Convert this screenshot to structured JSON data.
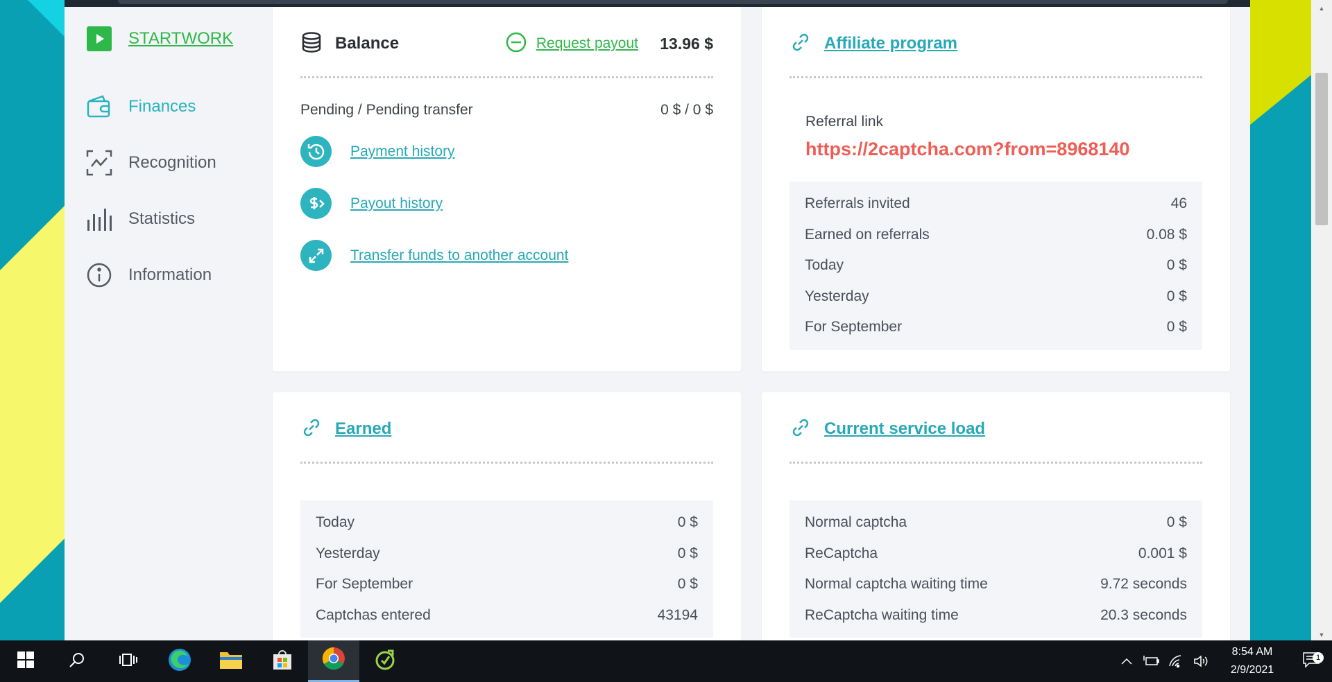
{
  "sidebar": {
    "items": [
      {
        "label": "STARTWORK",
        "icon": "play-icon"
      },
      {
        "label": "Finances",
        "icon": "wallet-icon"
      },
      {
        "label": "Recognition",
        "icon": "scan-icon"
      },
      {
        "label": "Statistics",
        "icon": "bar-chart-icon"
      },
      {
        "label": "Information",
        "icon": "info-icon"
      }
    ]
  },
  "balance": {
    "title": "Balance",
    "request_payout": "Request payout",
    "amount": "13.96 $",
    "pending_label": "Pending / Pending transfer",
    "pending_value": "0 $ / 0 $",
    "links": {
      "payment_history": "Payment history",
      "payout_history": "Payout history",
      "transfer": "Transfer funds to another account"
    }
  },
  "affiliate": {
    "title": "Affiliate program",
    "referral_label": "Referral link",
    "referral_url": "https://2captcha.com?from=8968140",
    "rows": [
      {
        "label": "Referrals invited",
        "value": "46"
      },
      {
        "label": "Earned on referrals",
        "value": "0.08 $"
      },
      {
        "label": "Today",
        "value": "0 $"
      },
      {
        "label": "Yesterday",
        "value": "0 $"
      },
      {
        "label": "For September",
        "value": "0 $"
      }
    ]
  },
  "earned": {
    "title": "Earned",
    "rows": [
      {
        "label": "Today",
        "value": "0 $"
      },
      {
        "label": "Yesterday",
        "value": "0 $"
      },
      {
        "label": "For September",
        "value": "0 $"
      },
      {
        "label": "Captchas entered",
        "value": "43194"
      }
    ]
  },
  "service_load": {
    "title": "Current service load",
    "rows": [
      {
        "label": "Normal captcha",
        "value": "0 $"
      },
      {
        "label": "ReCaptcha",
        "value": "0.001 $"
      },
      {
        "label": "Normal captcha waiting time",
        "value": "9.72 seconds"
      },
      {
        "label": "ReCaptcha waiting time",
        "value": "20.3 seconds"
      }
    ]
  },
  "taskbar": {
    "time": "8:54 AM",
    "date": "2/9/2021",
    "notification_count": "1"
  },
  "colors": {
    "accent": "#27b3bf",
    "green": "#2fb84a",
    "referral": "#ee5e55"
  }
}
